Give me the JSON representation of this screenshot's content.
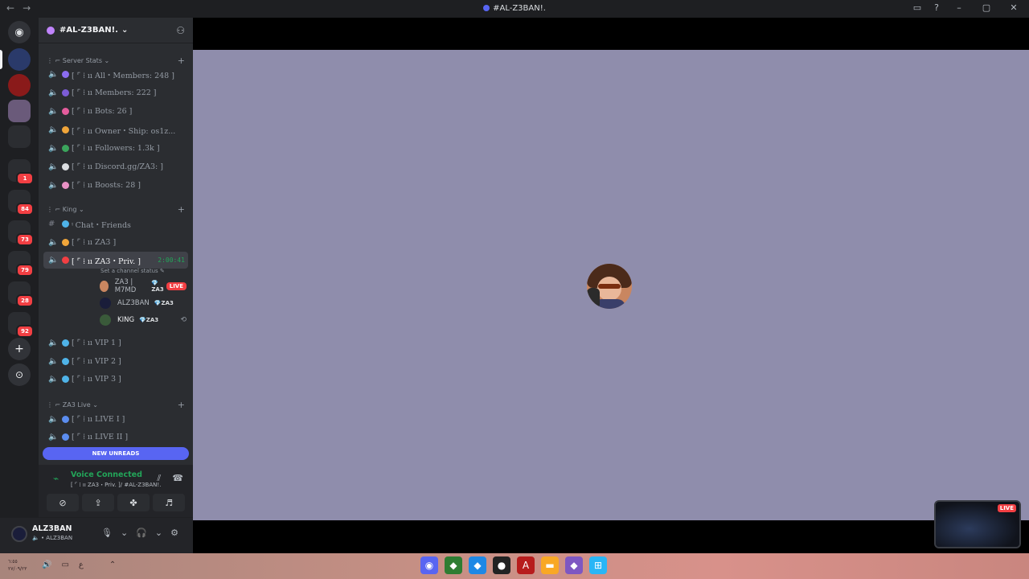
{
  "window": {
    "title": "#AL-Z3BAN!.",
    "nav_back": "←",
    "nav_forward": "→"
  },
  "guilds": {
    "badges": [
      "1",
      "84",
      "73",
      "79",
      "28",
      "92"
    ],
    "add_label": "+",
    "explore_label": "⊙"
  },
  "server": {
    "name": "#AL-Z3BAN!.",
    "categories": [
      {
        "label": "⋮ ⌐ Server Stats ⌄",
        "plus": "+"
      },
      {
        "label": "⋮ ⌐ King ⌄",
        "plus": "+"
      },
      {
        "label": "⋮ ⌐ ZA3 Live ⌄",
        "plus": "+"
      }
    ],
    "channels": [
      {
        "label": "[ ⌜ ⁞ ıı All・Members: 248 ]",
        "emoji_color": "#8b6cf0"
      },
      {
        "label": "[ ⌜ ⁞ ıı Members: 222 ]",
        "emoji_color": "#7c5cd6"
      },
      {
        "label": "[ ⌜ ⁞ ıı Bots: 26 ]",
        "emoji_color": "#e45c9c"
      },
      {
        "label": "[ ⌜ ⁞ ıı Owner・Ship: os1z...",
        "emoji_color": "#f0a53a"
      },
      {
        "label": "[ ⌜ ⁞ ıı Followers: 1.3k ]",
        "emoji_color": "#3ba55c"
      },
      {
        "label": "[ ⌜ ⁞ ıı Discord.gg/ZA3: ]",
        "emoji_color": "#dbdee1"
      },
      {
        "label": "[ ⌜ ⁞ ıı Boosts: 28 ]",
        "emoji_color": "#e891c4"
      },
      {
        "label": "ᵎ Chat・Friends",
        "emoji_color": "#4fb3e8"
      },
      {
        "label": "[ ⌜ ⁞ ıı ZA3 ]",
        "emoji_color": "#f0a53a"
      },
      {
        "label": "[ ⌜ ⁞ ıı ZA3・Priv. ]",
        "emoji_color": "#f23f43",
        "timer": "2:00:41"
      },
      {
        "label": "[ ⌜ ⁞ ıı VIP 1 ]",
        "emoji_color": "#4fb3e8"
      },
      {
        "label": "[ ⌜ ⁞ ıı VIP 2 ]",
        "emoji_color": "#4fb3e8"
      },
      {
        "label": "[ ⌜ ⁞ ıı VIP 3 ]",
        "emoji_color": "#4fb3e8"
      },
      {
        "label": "[ ⌜ ⁞ ıı LIVE I ]",
        "emoji_color": "#5b8def"
      },
      {
        "label": "[ ⌜ ⁞ ıı LIVE II ]",
        "emoji_color": "#5b8def"
      }
    ],
    "channel_status": "Set a channel status",
    "voice_users": [
      {
        "name": "ZA3 | M7MD",
        "tag": "ZA3",
        "live": "LIVE",
        "avatar_color": "#c98660"
      },
      {
        "name": "ALZ3BAN",
        "tag": "ZA3",
        "avatar_color": "#1a1d3a"
      },
      {
        "name": "KING",
        "tag": "ZA3",
        "extra_icon": "⟲",
        "avatar_color": "#3a5a3a"
      }
    ],
    "new_unreads": "NEW UNREADS"
  },
  "voice": {
    "title": "Voice Connected",
    "subtitle": "[ ⌜ ⁞ ıı ZA3・Priv. ]/ #AL-Z3BAN!."
  },
  "user": {
    "name": "ALZ3BAN",
    "sub": "• ALZ3BAN"
  },
  "stage": {
    "pip_live": "LIVE",
    "tile_color": "#8f8dac"
  },
  "taskbar": {
    "time": "٦:٥٥",
    "date": "٢٧/٠٩/٢٣",
    "lang": "ع"
  }
}
